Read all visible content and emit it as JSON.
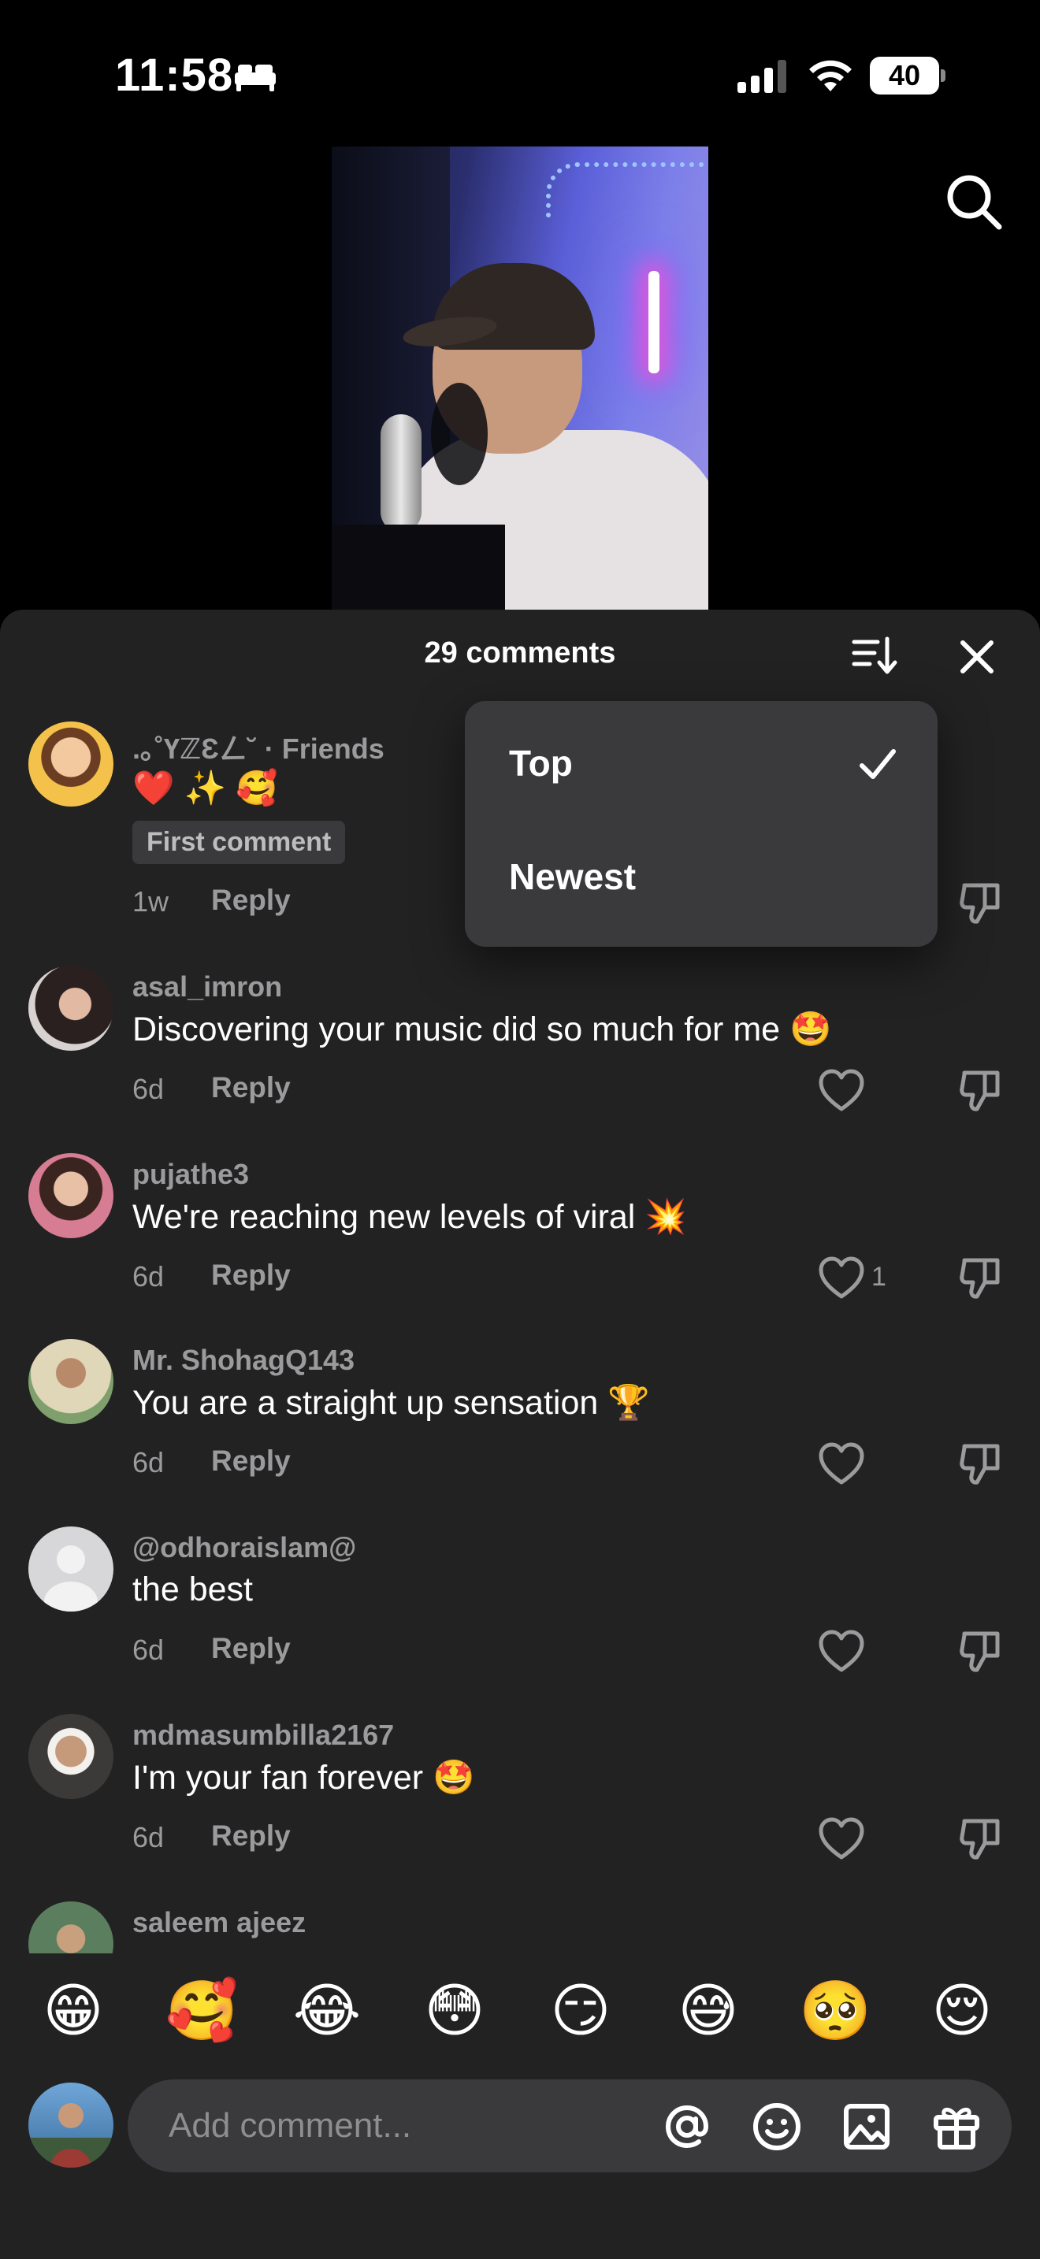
{
  "status_bar": {
    "time": "11:58",
    "battery": "40"
  },
  "sheet": {
    "title": "29 comments"
  },
  "sort_menu": {
    "options": [
      {
        "label": "Top",
        "selected": true
      },
      {
        "label": "Newest",
        "selected": false
      }
    ]
  },
  "comments": [
    {
      "username": ".｡˚ҮℤƐㄥ˘ · Friends",
      "text": "❤️ ✨ 🥰",
      "tag": "First comment",
      "time": "1w",
      "reply": "Reply",
      "likes": ""
    },
    {
      "username": "asal_imron",
      "text": "Discovering your music did so much for me 🤩",
      "time": "6d",
      "reply": "Reply",
      "likes": ""
    },
    {
      "username": "pujathe3",
      "text": "We're reaching new levels of viral 💥",
      "time": "6d",
      "reply": "Reply",
      "likes": "1"
    },
    {
      "username": "Mr. ShohagQ143",
      "text": "You are a straight up sensation 🏆",
      "time": "6d",
      "reply": "Reply",
      "likes": ""
    },
    {
      "username": "@odhoraislam@",
      "text": "the best",
      "time": "6d",
      "reply": "Reply",
      "likes": ""
    },
    {
      "username": "mdmasumbilla2167",
      "text": "I'm your fan forever 🤩",
      "time": "6d",
      "reply": "Reply",
      "likes": ""
    },
    {
      "username": "saleem ajeez",
      "text": "",
      "time": "",
      "reply": "",
      "likes": ""
    }
  ],
  "emoji_bar": [
    "😁",
    "🥰",
    "😂",
    "😳",
    "😏",
    "😅",
    "🥺",
    "😌"
  ],
  "composer": {
    "placeholder": "Add comment..."
  },
  "colors": {
    "background": "#000000",
    "sheet": "#222223",
    "muted_text": "#9b9b9d",
    "dropdown": "#3a3a3c"
  }
}
